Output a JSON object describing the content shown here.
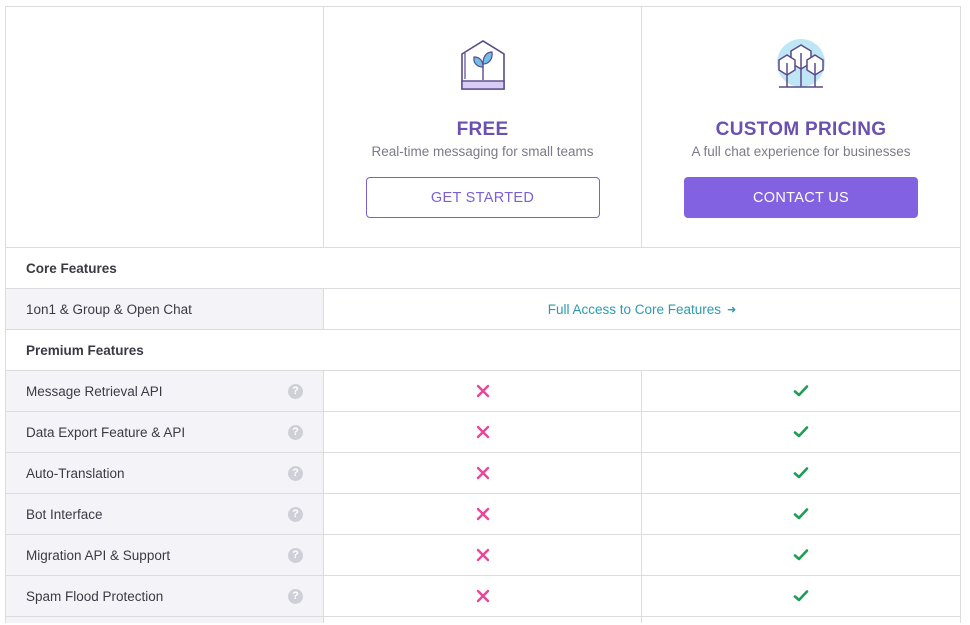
{
  "plans": [
    {
      "title": "FREE",
      "subtitle": "Real-time messaging for small teams",
      "button": "GET STARTED",
      "icon": "greenhouse-plant-icon"
    },
    {
      "title": "CUSTOM PRICING",
      "subtitle": "A full chat experience for businesses",
      "button": "CONTACT US",
      "icon": "trees-icon"
    }
  ],
  "core": {
    "section_label": "Core Features",
    "feature": "1on1 & Group & Open Chat",
    "link_text": "Full Access to Core Features"
  },
  "premium": {
    "section_label": "Premium Features",
    "features": [
      {
        "name": "Message Retrieval API",
        "free": false,
        "custom": true
      },
      {
        "name": "Data Export Feature & API",
        "free": false,
        "custom": true
      },
      {
        "name": "Auto-Translation",
        "free": false,
        "custom": true
      },
      {
        "name": "Bot Interface",
        "free": false,
        "custom": true
      },
      {
        "name": "Migration API & Support",
        "free": false,
        "custom": true
      },
      {
        "name": "Spam Flood Protection",
        "free": false,
        "custom": true
      }
    ]
  },
  "help_glyph": "?",
  "colors": {
    "accent": "#8262e0",
    "check": "#1e9e55",
    "cross": "#e8479a",
    "link": "#2a9bb0"
  }
}
